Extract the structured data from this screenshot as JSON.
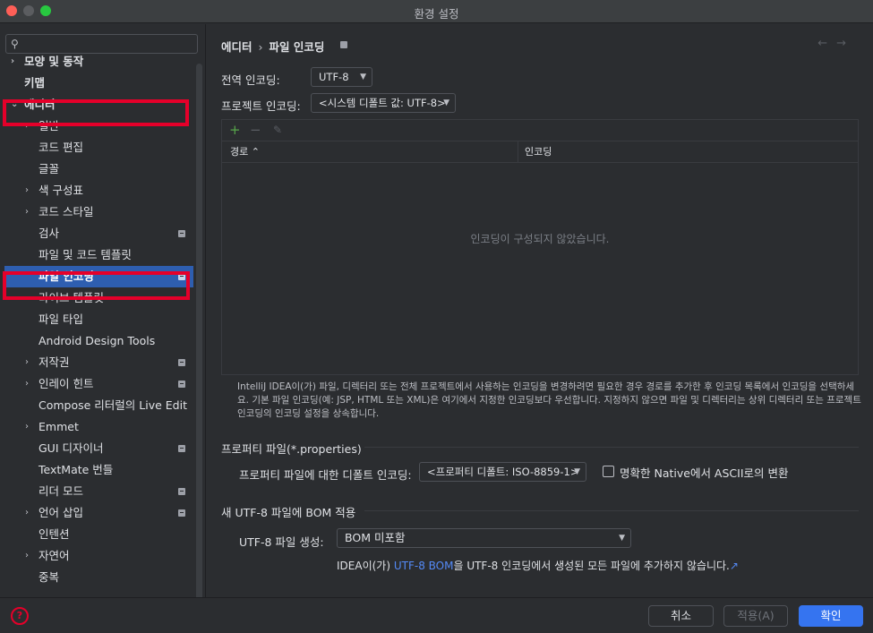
{
  "window": {
    "title": "환경 설정"
  },
  "sidebar": {
    "search_placeholder": "",
    "items": [
      {
        "label": "모양 및 동작",
        "chevron": "›",
        "bold": true
      },
      {
        "label": "키맵",
        "bold": true
      },
      {
        "label": "에디터",
        "chevron": "⌄",
        "bold": true
      },
      {
        "label": "일반",
        "chevron": "›"
      },
      {
        "label": "코드 편집"
      },
      {
        "label": "글꼴"
      },
      {
        "label": "색 구성표",
        "chevron": "›"
      },
      {
        "label": "코드 스타일",
        "chevron": "›"
      },
      {
        "label": "검사",
        "badge": true
      },
      {
        "label": "파일 및 코드 템플릿"
      },
      {
        "label": "파일 인코딩",
        "badge": true,
        "selected": true
      },
      {
        "label": "라이브 템플릿"
      },
      {
        "label": "파일 타입"
      },
      {
        "label": "Android Design Tools"
      },
      {
        "label": "저작권",
        "chevron": "›",
        "badge": true
      },
      {
        "label": "인레이 힌트",
        "chevron": "›",
        "badge": true
      },
      {
        "label": "Compose 리터럴의 Live Edit"
      },
      {
        "label": "Emmet",
        "chevron": "›"
      },
      {
        "label": "GUI 디자이너",
        "badge": true
      },
      {
        "label": "TextMate 번들"
      },
      {
        "label": "리더 모드",
        "badge": true
      },
      {
        "label": "언어 삽입",
        "chevron": "›",
        "badge": true
      },
      {
        "label": "인텐션"
      },
      {
        "label": "자연어",
        "chevron": "›"
      },
      {
        "label": "중복"
      }
    ]
  },
  "breadcrumb": {
    "parent": "에디터",
    "current": "파일 인코딩"
  },
  "encoding": {
    "global_label": "전역 인코딩:",
    "global_value": "UTF-8",
    "project_label": "프로젝트 인코딩:",
    "project_value": "<시스템 디폴트 값: UTF-8>"
  },
  "table": {
    "add_icon": "+",
    "remove_icon": "−",
    "edit_icon": "✎",
    "col_path": "경로",
    "col_encoding": "인코딩",
    "empty_text": "인코딩이 구성되지 않았습니다."
  },
  "help_text": "IntelliJ IDEA이(가) 파일, 디렉터리 또는 전체 프로젝트에서 사용하는 인코딩을 변경하려면 필요한 경우 경로를 추가한 후 인코딩 목록에서 인코딩을 선택하세요. 기본 파일 인코딩(예: JSP, HTML 또는 XML)은 여기에서 지정한 인코딩보다 우선합니다. 지정하지 않으면 파일 및 디렉터리는 상위 디렉터리 또는 프로젝트 인코딩의 인코딩 설정을 상속합니다.",
  "properties": {
    "section_title": "프로퍼티 파일(*.properties)",
    "default_label": "프로퍼티 파일에 대한 디폴트 인코딩:",
    "default_value": "<프로퍼티 디폴트: ISO-8859-1>",
    "native_ascii_label": "명확한 Native에서 ASCII로의 변환",
    "native_ascii_checked": false
  },
  "bom": {
    "section_title": "새 UTF-8 파일에 BOM 적용",
    "create_label": "UTF-8 파일 생성:",
    "create_value": "BOM 미포함",
    "note_prefix": "IDEA이(가) ",
    "note_link": "UTF-8 BOM",
    "note_suffix": "을 UTF-8 인코딩에서 생성된 모든 파일에 추가하지 않습니다.",
    "external_icon": "↗"
  },
  "footer": {
    "help_icon": "?",
    "cancel": "취소",
    "apply": "적용(A)",
    "ok": "확인"
  },
  "colors": {
    "accent": "#3574f0",
    "selection": "#2e5eb0",
    "highlight_box": "#e5002a",
    "link": "#548af7"
  }
}
